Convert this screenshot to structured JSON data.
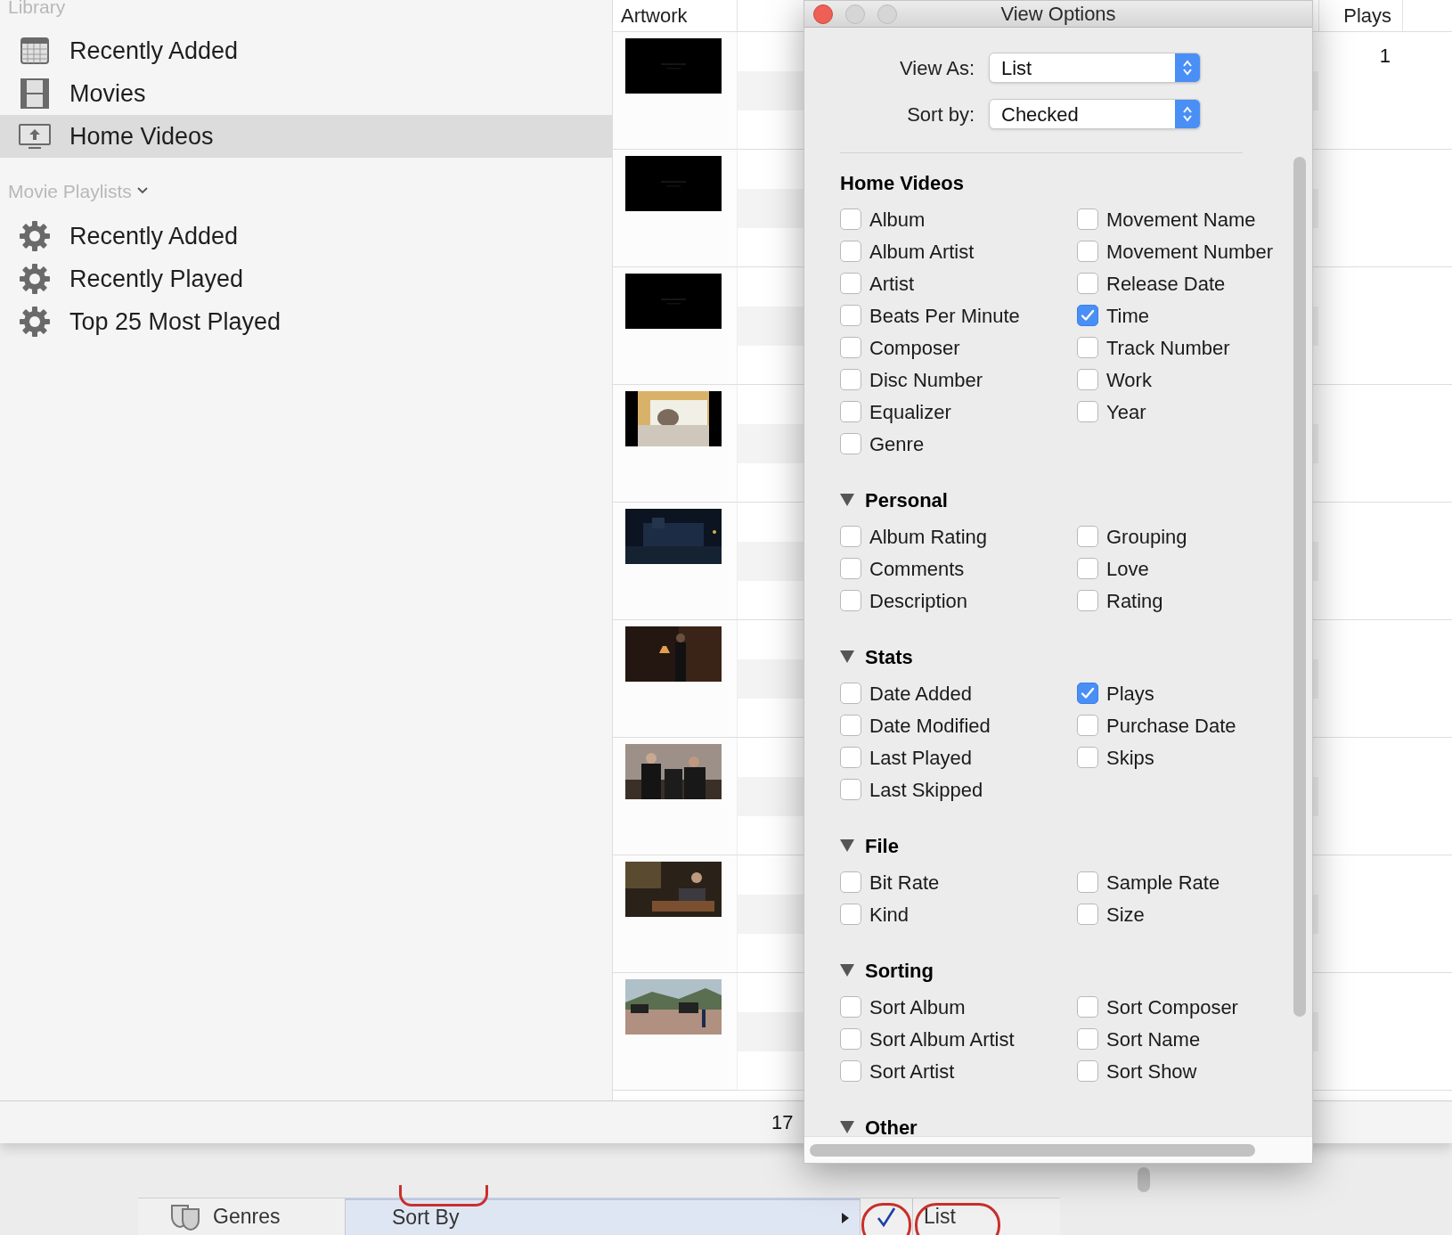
{
  "sidebar": {
    "sections": [
      {
        "title": "Library",
        "kind": "library",
        "items": [
          {
            "label": "Recently Added",
            "selected": false
          },
          {
            "label": "Movies",
            "selected": false
          },
          {
            "label": "Home Videos",
            "selected": true
          }
        ]
      },
      {
        "title": "Movie Playlists",
        "kind": "playlists",
        "items": [
          {
            "label": "Recently Added",
            "selected": false
          },
          {
            "label": "Recently Played",
            "selected": false
          },
          {
            "label": "Top 25 Most Played",
            "selected": false
          }
        ]
      }
    ]
  },
  "table": {
    "columns": [
      "Artwork",
      "Plays"
    ],
    "rows": [
      {
        "artwork": {
          "kind": "picture"
        },
        "plays": "1"
      },
      {
        "artwork": {
          "kind": "picture"
        }
      },
      {
        "artwork": {
          "kind": "picture"
        }
      },
      {
        "artwork": {
          "kind": "picture"
        }
      },
      {
        "artwork": {
          "kind": "picture"
        }
      },
      {
        "artwork": {
          "kind": "picture"
        }
      },
      {
        "artwork": {
          "kind": "picture"
        }
      },
      {
        "artwork": {
          "kind": "picture"
        }
      },
      {
        "artwork": {
          "kind": "picture"
        }
      }
    ]
  },
  "status_bar": {
    "text": "17"
  },
  "bottom_menu": {
    "items": [
      {
        "label": "Genres",
        "kind": "category",
        "selected": false
      },
      {
        "label": "Sort By",
        "kind": "submenu",
        "selected": true
      },
      {
        "label": "List",
        "kind": "check",
        "checked": true,
        "selected": false
      }
    ]
  },
  "dialog": {
    "title": "View Options",
    "fields": [
      {
        "label": "View As:",
        "value": "List"
      },
      {
        "label": "Sort by:",
        "value": "Checked"
      }
    ],
    "sections": [
      {
        "title": "Home Videos",
        "kind": "plain",
        "columns": [
          [
            {
              "label": "Album",
              "checked": false
            },
            {
              "label": "Album Artist",
              "checked": false
            },
            {
              "label": "Artist",
              "checked": false
            },
            {
              "label": "Beats Per Minute",
              "checked": false
            },
            {
              "label": "Composer",
              "checked": false
            },
            {
              "label": "Disc Number",
              "checked": false
            },
            {
              "label": "Equalizer",
              "checked": false
            },
            {
              "label": "Genre",
              "checked": false
            }
          ],
          [
            {
              "label": "Movement Name",
              "checked": false
            },
            {
              "label": "Movement Number",
              "checked": false
            },
            {
              "label": "Release Date",
              "checked": false
            },
            {
              "label": "Time",
              "checked": true
            },
            {
              "label": "Track Number",
              "checked": false
            },
            {
              "label": "Work",
              "checked": false
            },
            {
              "label": "Year",
              "checked": false
            }
          ]
        ]
      },
      {
        "title": "Personal",
        "kind": "disclosure",
        "expanded": true,
        "columns": [
          [
            {
              "label": "Album Rating",
              "checked": false
            },
            {
              "label": "Comments",
              "checked": false
            },
            {
              "label": "Description",
              "checked": false
            }
          ],
          [
            {
              "label": "Grouping",
              "checked": false
            },
            {
              "label": "Love",
              "checked": false
            },
            {
              "label": "Rating",
              "checked": false
            }
          ]
        ]
      },
      {
        "title": "Stats",
        "kind": "disclosure",
        "expanded": true,
        "columns": [
          [
            {
              "label": "Date Added",
              "checked": false
            },
            {
              "label": "Date Modified",
              "checked": false
            },
            {
              "label": "Last Played",
              "checked": false
            },
            {
              "label": "Last Skipped",
              "checked": false
            }
          ],
          [
            {
              "label": "Plays",
              "checked": true
            },
            {
              "label": "Purchase Date",
              "checked": false
            },
            {
              "label": "Skips",
              "checked": false
            }
          ]
        ]
      },
      {
        "title": "File",
        "kind": "disclosure",
        "expanded": true,
        "columns": [
          [
            {
              "label": "Bit Rate",
              "checked": false
            },
            {
              "label": "Kind",
              "checked": false
            }
          ],
          [
            {
              "label": "Sample Rate",
              "checked": false
            },
            {
              "label": "Size",
              "checked": false
            }
          ]
        ]
      },
      {
        "title": "Sorting",
        "kind": "disclosure",
        "expanded": true,
        "columns": [
          [
            {
              "label": "Sort Album",
              "checked": false
            },
            {
              "label": "Sort Album Artist",
              "checked": false
            },
            {
              "label": "Sort Artist",
              "checked": false
            }
          ],
          [
            {
              "label": "Sort Composer",
              "checked": false
            },
            {
              "label": "Sort Name",
              "checked": false
            },
            {
              "label": "Sort Show",
              "checked": false
            }
          ]
        ]
      },
      {
        "title": "Other",
        "kind": "disclosure",
        "expanded": true,
        "columns": [
          [],
          []
        ]
      }
    ]
  }
}
